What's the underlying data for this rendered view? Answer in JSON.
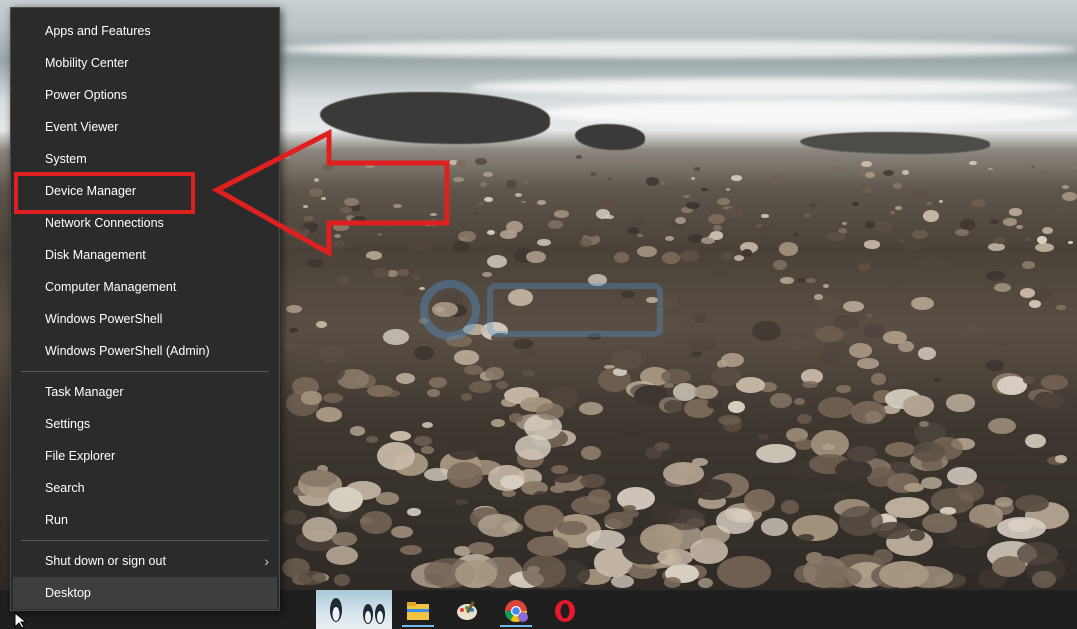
{
  "menu": {
    "items": [
      {
        "label": "Apps and Features"
      },
      {
        "label": "Mobility Center"
      },
      {
        "label": "Power Options"
      },
      {
        "label": "Event Viewer"
      },
      {
        "label": "System"
      },
      {
        "label": "Device Manager"
      },
      {
        "label": "Network Connections"
      },
      {
        "label": "Disk Management"
      },
      {
        "label": "Computer Management"
      },
      {
        "label": "Windows PowerShell"
      },
      {
        "label": "Windows PowerShell (Admin)"
      }
    ],
    "items2": [
      {
        "label": "Task Manager"
      },
      {
        "label": "Settings"
      },
      {
        "label": "File Explorer"
      },
      {
        "label": "Search"
      },
      {
        "label": "Run"
      }
    ],
    "shutdown_label": "Shut down or sign out",
    "desktop_label": "Desktop"
  },
  "annotation": {
    "highlight_color": "#e02020"
  },
  "taskbar": {
    "icons": [
      "file-explorer-icon",
      "paint-icon",
      "chrome-icon",
      "opera-icon"
    ]
  }
}
